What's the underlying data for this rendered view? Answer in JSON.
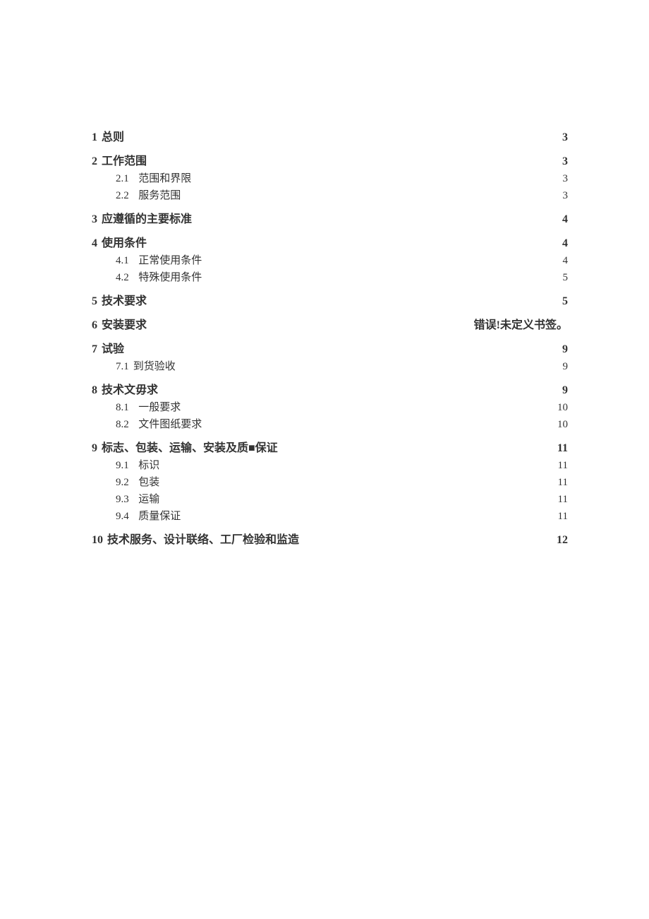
{
  "toc": [
    {
      "level": 1,
      "num": "1",
      "label": "总则",
      "page": "3"
    },
    {
      "level": 1,
      "num": "2",
      "label": "工作范围",
      "page": "3"
    },
    {
      "level": 2,
      "num": "2.1",
      "label": "范围和界限",
      "page": "3"
    },
    {
      "level": 2,
      "num": "2.2",
      "label": "服务范围",
      "page": "3"
    },
    {
      "level": 1,
      "num": "3",
      "label": "应遵循的主要标准",
      "page": "4"
    },
    {
      "level": 1,
      "num": "4",
      "label": "使用条件",
      "page": "4"
    },
    {
      "level": 2,
      "num": "4.1",
      "label": "正常使用条件",
      "page": "4"
    },
    {
      "level": 2,
      "num": "4.2",
      "label": "特殊使用条件",
      "page": "5"
    },
    {
      "level": 1,
      "num": "5",
      "label": "技术要求",
      "page": "5"
    },
    {
      "level": 1,
      "num": "6",
      "label": "安装要求",
      "page": "错误!未定义书签。"
    },
    {
      "level": 1,
      "num": "7",
      "label": "试验",
      "page": "9"
    },
    {
      "level": 2,
      "num": "7.1",
      "label": "到货验收",
      "page": "9",
      "nonum": true
    },
    {
      "level": 1,
      "num": "8",
      "label": "技术文毋求",
      "page": "9"
    },
    {
      "level": 2,
      "num": "8.1",
      "label": "一般要求",
      "page": "10"
    },
    {
      "level": 2,
      "num": "8.2",
      "label": "文件图纸要求",
      "page": "10"
    },
    {
      "level": 1,
      "num": "9",
      "label": "标志、包装、运输、安装及质■保证",
      "page": "11"
    },
    {
      "level": 2,
      "num": "9.1",
      "label": "标识",
      "page": "11"
    },
    {
      "level": 2,
      "num": "9.2",
      "label": "包装",
      "page": "11"
    },
    {
      "level": 2,
      "num": "9.3",
      "label": "运输",
      "page": "11"
    },
    {
      "level": 2,
      "num": "9.4",
      "label": "质量保证",
      "page": "11"
    },
    {
      "level": 1,
      "num": "10",
      "label": "技术服务、设计联络、工厂检验和监造",
      "page": "12"
    }
  ]
}
